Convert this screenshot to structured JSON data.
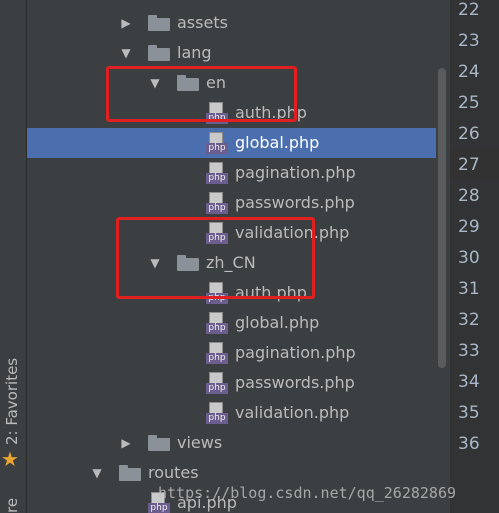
{
  "sidebar": {
    "favorites_label": "2: Favorites",
    "partial_label": "re"
  },
  "tree": {
    "rows": [
      {
        "label": "assets",
        "type": "folder",
        "expanded": false
      },
      {
        "label": "lang",
        "type": "folder",
        "expanded": true
      },
      {
        "label": "en",
        "type": "folder",
        "expanded": true
      },
      {
        "label": "auth.php",
        "type": "php"
      },
      {
        "label": "global.php",
        "type": "php",
        "selected": true
      },
      {
        "label": "pagination.php",
        "type": "php"
      },
      {
        "label": "passwords.php",
        "type": "php"
      },
      {
        "label": "validation.php",
        "type": "php"
      },
      {
        "label": "zh_CN",
        "type": "folder",
        "expanded": true
      },
      {
        "label": "auth.php",
        "type": "php"
      },
      {
        "label": "global.php",
        "type": "php"
      },
      {
        "label": "pagination.php",
        "type": "php"
      },
      {
        "label": "passwords.php",
        "type": "php"
      },
      {
        "label": "validation.php",
        "type": "php"
      },
      {
        "label": "views",
        "type": "folder",
        "expanded": false
      },
      {
        "label": "routes",
        "type": "folder",
        "expanded": true
      },
      {
        "label": "api.php",
        "type": "php"
      }
    ],
    "php_badge": "php",
    "arrow_collapsed": "▶",
    "arrow_expanded": "▼"
  },
  "gutter": {
    "line_numbers": [
      "22",
      "23",
      "24",
      "25",
      "26",
      "27",
      "28",
      "29",
      "30",
      "31",
      "32",
      "33",
      "34",
      "35",
      "36"
    ]
  },
  "watermark": "https://blog.csdn.net/qq_26282869",
  "colors": {
    "background": "#3c3f41",
    "selection": "#4b6eaf",
    "highlight_box": "#e02020",
    "php_badge": "#6c5d8f"
  }
}
